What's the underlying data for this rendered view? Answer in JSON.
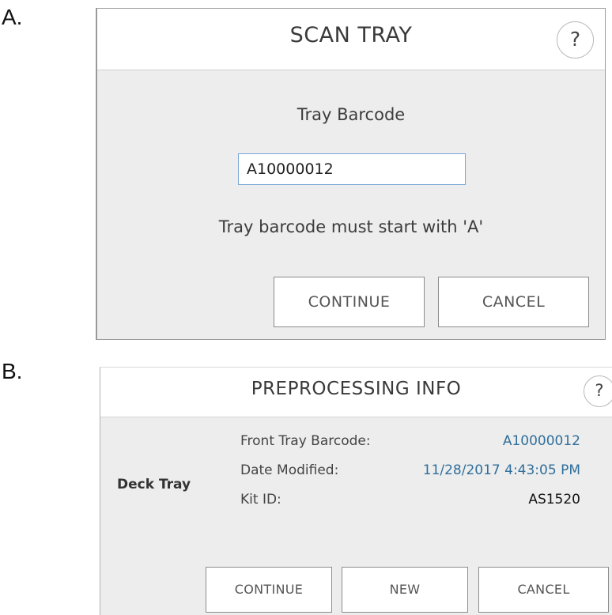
{
  "panels": {
    "a_label": "A.",
    "b_label": "B."
  },
  "scan_tray": {
    "title": "SCAN TRAY",
    "help": "?",
    "field_label": "Tray Barcode",
    "barcode_value": "A10000012",
    "hint": "Tray barcode must start with 'A'",
    "continue_label": "CONTINUE",
    "cancel_label": "CANCEL"
  },
  "preprocessing": {
    "title": "PREPROCESSING INFO",
    "help": "?",
    "section_label": "Deck Tray",
    "rows": [
      {
        "key": "Front Tray Barcode:",
        "value": "A10000012",
        "color": "#2f6f9b"
      },
      {
        "key": "Date Modified:",
        "value": "11/28/2017 4:43:05 PM",
        "color": "#2f6f9b"
      },
      {
        "key": "Kit ID:",
        "value": "AS1520",
        "color": "#111111"
      }
    ],
    "continue_label": "CONTINUE",
    "new_label": "NEW",
    "cancel_label": "CANCEL"
  }
}
